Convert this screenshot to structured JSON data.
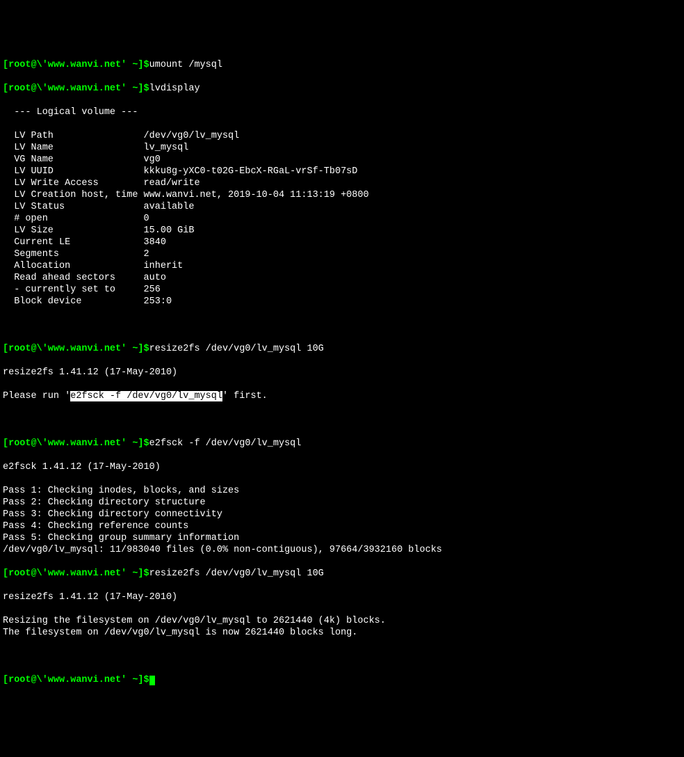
{
  "prompt": "[root@\\'www.wanvi.net' ~]$",
  "cmd1": "umount /mysql",
  "cmd2": "lvdisplay",
  "lvdisp": {
    "header": "  --- Logical volume ---",
    "rows": [
      {
        "k": "  LV Path                ",
        "v": "/dev/vg0/lv_mysql"
      },
      {
        "k": "  LV Name                ",
        "v": "lv_mysql"
      },
      {
        "k": "  VG Name                ",
        "v": "vg0"
      },
      {
        "k": "  LV UUID                ",
        "v": "kkku8g-yXC0-t02G-EbcX-RGaL-vrSf-Tb07sD"
      },
      {
        "k": "  LV Write Access        ",
        "v": "read/write"
      },
      {
        "k": "  LV Creation host, time ",
        "v": "www.wanvi.net, 2019-10-04 11:13:19 +0800"
      },
      {
        "k": "  LV Status              ",
        "v": "available"
      },
      {
        "k": "  # open                 ",
        "v": "0"
      },
      {
        "k": "  LV Size                ",
        "v": "15.00 GiB"
      },
      {
        "k": "  Current LE             ",
        "v": "3840"
      },
      {
        "k": "  Segments               ",
        "v": "2"
      },
      {
        "k": "  Allocation             ",
        "v": "inherit"
      },
      {
        "k": "  Read ahead sectors     ",
        "v": "auto"
      },
      {
        "k": "  - currently set to     ",
        "v": "256"
      },
      {
        "k": "  Block device           ",
        "v": "253:0"
      }
    ]
  },
  "cmd3": "resize2fs /dev/vg0/lv_mysql 10G",
  "resize_version": "resize2fs 1.41.12 (17-May-2010)",
  "please_run_pre": "Please run '",
  "please_run_hl": "e2fsck -f /dev/vg0/lv_mysql",
  "please_run_post": "' first.",
  "cmd4": "e2fsck -f /dev/vg0/lv_mysql",
  "e2fsck_version": "e2fsck 1.41.12 (17-May-2010)",
  "e2fsck_lines": [
    "Pass 1: Checking inodes, blocks, and sizes",
    "Pass 2: Checking directory structure",
    "Pass 3: Checking directory connectivity",
    "Pass 4: Checking reference counts",
    "Pass 5: Checking group summary information",
    "/dev/vg0/lv_mysql: 11/983040 files (0.0% non-contiguous), 97664/3932160 blocks"
  ],
  "cmd5": "resize2fs /dev/vg0/lv_mysql 10G",
  "resize_version2": "resize2fs 1.41.12 (17-May-2010)",
  "resize_lines": [
    "Resizing the filesystem on /dev/vg0/lv_mysql to 2621440 (4k) blocks.",
    "The filesystem on /dev/vg0/lv_mysql is now 2621440 blocks long."
  ]
}
